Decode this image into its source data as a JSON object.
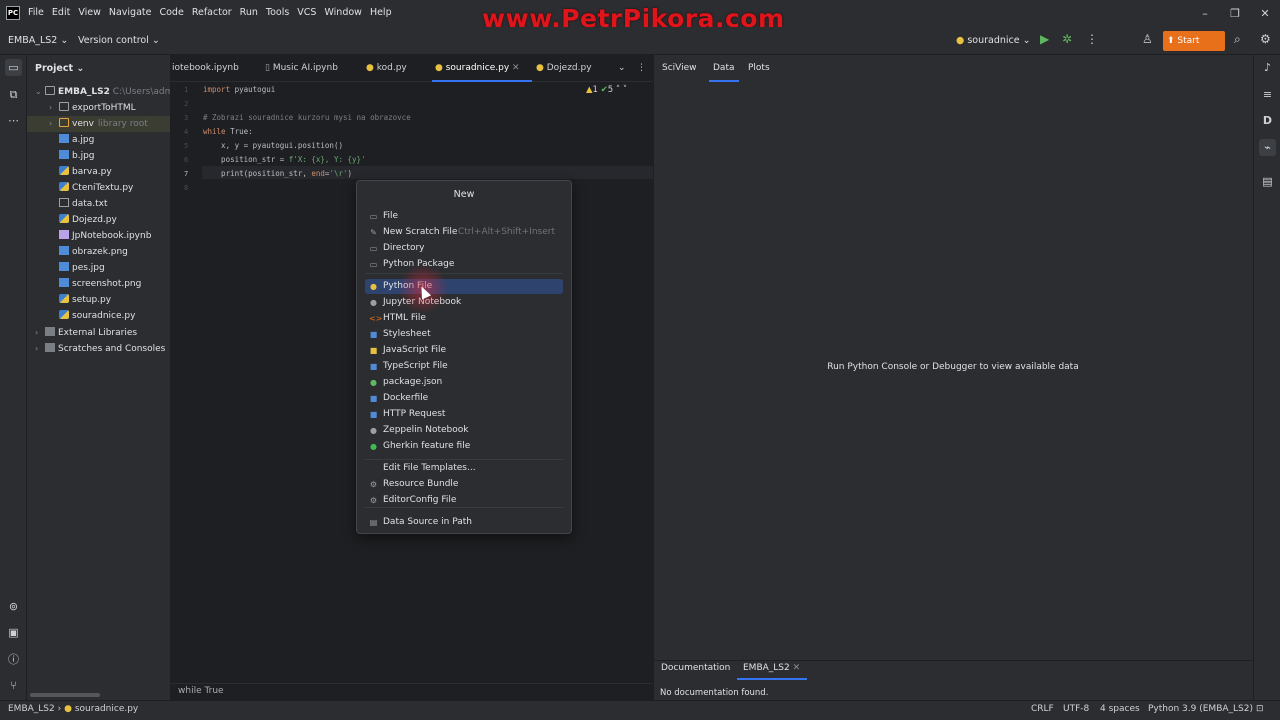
{
  "watermark": "www.PetrPikora.com",
  "menu": [
    "File",
    "Edit",
    "View",
    "Navigate",
    "Code",
    "Refactor",
    "Run",
    "Tools",
    "VCS",
    "Window",
    "Help"
  ],
  "toolbar": {
    "project": "EMBA_LS2",
    "vcs": "Version control",
    "run_config": "souradnice",
    "start_exam": "Start Exam"
  },
  "project_panel": {
    "title": "Project",
    "root": "EMBA_LS2",
    "root_path": "C:\\Users\\adm",
    "items": [
      {
        "name": "exportToHTML",
        "type": "folder"
      },
      {
        "name": "venv",
        "suffix": "library root",
        "type": "folder"
      },
      {
        "name": "a.jpg",
        "type": "img"
      },
      {
        "name": "b.jpg",
        "type": "img"
      },
      {
        "name": "barva.py",
        "type": "py"
      },
      {
        "name": "CteniTextu.py",
        "type": "py"
      },
      {
        "name": "data.txt",
        "type": "txt"
      },
      {
        "name": "Dojezd.py",
        "type": "py"
      },
      {
        "name": "JpNotebook.ipynb",
        "type": "nb"
      },
      {
        "name": "obrazek.png",
        "type": "img"
      },
      {
        "name": "pes.jpg",
        "type": "img"
      },
      {
        "name": "screenshot.png",
        "type": "img"
      },
      {
        "name": "setup.py",
        "type": "py"
      },
      {
        "name": "souradnice.py",
        "type": "py"
      }
    ],
    "external": "External Libraries",
    "scratches": "Scratches and Consoles"
  },
  "editor": {
    "tabs": [
      "iotebook.ipynb",
      "Music AI.ipynb",
      "kod.py",
      "souradnice.py",
      "Dojezd.py"
    ],
    "active_tab": "souradnice.py",
    "inspections": {
      "warnings": "1",
      "ok": "5"
    },
    "line_numbers": [
      "1",
      "2",
      "3",
      "4",
      "5",
      "6",
      "7",
      "8"
    ],
    "code": {
      "l1_kw": "import",
      "l1_rest": " pyautogui",
      "l3": "# Zobrazi souradnice kurzoru mysi na obrazovce",
      "l4_kw": "while",
      "l4_rest": " True:",
      "l5": "    x, y = pyautogui.position()",
      "l6_a": "    position_str = ",
      "l6_s": "f'X: {x}, Y: {y}'",
      "l7_a": "    print(position_str, ",
      "l7_kw": "end",
      "l7_b": "=",
      "l7_s": "'\\r'",
      "l7_c": ")"
    },
    "breadcrumb": "while True"
  },
  "popup": {
    "title": "New",
    "items": [
      {
        "label": "File",
        "icon": "file-icon",
        "glyph": "▭",
        "color": "#9aa0a6"
      },
      {
        "label": "New Scratch File",
        "shortcut": "Ctrl+Alt+Shift+Insert",
        "icon": "scratch-file-icon",
        "glyph": "✎",
        "color": "#9aa0a6"
      },
      {
        "label": "Directory",
        "icon": "folder-icon",
        "glyph": "▭",
        "color": "#9aa0a6"
      },
      {
        "label": "Python Package",
        "icon": "package-icon",
        "glyph": "▭",
        "color": "#9aa0a6"
      },
      {
        "label": "Python File",
        "icon": "python-icon",
        "glyph": "●",
        "color": "#e8c140",
        "highlighted": true
      },
      {
        "label": "Jupyter Notebook",
        "icon": "jupyter-icon",
        "glyph": "●",
        "color": "#9aa0a6"
      },
      {
        "label": "HTML File",
        "icon": "html-icon",
        "glyph": "<>",
        "color": "#e8701a"
      },
      {
        "label": "Stylesheet",
        "icon": "css-icon",
        "glyph": "■",
        "color": "#4f8bd6"
      },
      {
        "label": "JavaScript File",
        "icon": "javascript-icon",
        "glyph": "■",
        "color": "#e8c140"
      },
      {
        "label": "TypeScript File",
        "icon": "typescript-icon",
        "glyph": "■",
        "color": "#4f8bd6"
      },
      {
        "label": "package.json",
        "icon": "npm-icon",
        "glyph": "●",
        "color": "#5fb85f"
      },
      {
        "label": "Dockerfile",
        "icon": "docker-icon",
        "glyph": "■",
        "color": "#4f8bd6"
      },
      {
        "label": "HTTP Request",
        "icon": "http-icon",
        "glyph": "■",
        "color": "#4f8bd6"
      },
      {
        "label": "Zeppelin Notebook",
        "icon": "zeppelin-icon",
        "glyph": "●",
        "color": "#9aa0a6"
      },
      {
        "label": "Gherkin feature file",
        "icon": "gherkin-icon",
        "glyph": "●",
        "color": "#3fb950"
      },
      {
        "label": "Edit File Templates...",
        "icon": "",
        "glyph": "",
        "color": "#9aa0a6"
      },
      {
        "label": "Resource Bundle",
        "icon": "resource-bundle-icon",
        "glyph": "⚙",
        "color": "#9aa0a6"
      },
      {
        "label": "EditorConfig File",
        "icon": "editorconfig-icon",
        "glyph": "⚙",
        "color": "#9aa0a6"
      },
      {
        "label": "Data Source in Path",
        "icon": "datasource-icon",
        "glyph": "▤",
        "color": "#9aa0a6"
      }
    ]
  },
  "sciview": {
    "tabs": [
      "SciView",
      "Data",
      "Plots"
    ],
    "empty_message": "Run Python Console or Debugger to view available data"
  },
  "docs": {
    "tab1": "Documentation",
    "tab2": "EMBA_LS2",
    "empty": "No documentation found."
  },
  "statusbar": {
    "project": "EMBA_LS2",
    "file": "souradnice.py",
    "line_sep": "CRLF",
    "encoding": "UTF-8",
    "indent": "4 spaces",
    "interpreter": "Python 3.9 (EMBA_LS2)"
  }
}
